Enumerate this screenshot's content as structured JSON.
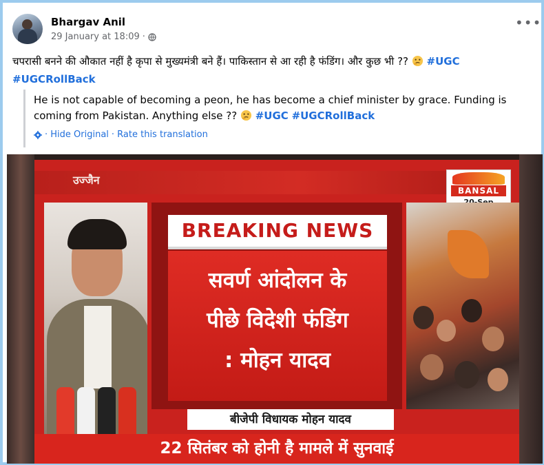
{
  "post": {
    "author": "Bhargav Anil",
    "timestamp": "29 January at 18:09",
    "separator": "·",
    "privacy_icon": "globe-icon",
    "more_icon": "more-options-icon",
    "text": "चपरासी बनने की औकात नहीं है कृपा से मुख्यमंत्री बने हैं।  पाकिस्तान से आ रही है फंडिंग। और कुछ भी ?? ",
    "hashtags": [
      "#UGC",
      "#UGCRollBack"
    ]
  },
  "translation": {
    "text": "He is not capable of becoming a peon, he has become a chief minister by grace. Funding is coming from Pakistan. Anything else ?? ",
    "hashtags": [
      "#UGC",
      "#UGCRollBack"
    ],
    "gear_icon": "gear-icon",
    "hide_original": "· Hide Original",
    "rate_translation": "· Rate this translation"
  },
  "media": {
    "location": "उज्जैन",
    "channel": "BANSAL",
    "date": "20-Sep",
    "breaking": "BREAKING NEWS",
    "headline_lines": [
      "सवर्ण आंदोलन के",
      "पीछे विदेशी फंडिंग",
      ": मोहन यादव"
    ],
    "lower_third": "बीजेपी विधायक मोहन यादव",
    "ticker": "22 सितंबर को होनी है मामले में सुनवाई"
  },
  "colors": {
    "frame_border": "#9ccbee",
    "link_blue": "#216fdb",
    "news_red": "#c9221e"
  }
}
